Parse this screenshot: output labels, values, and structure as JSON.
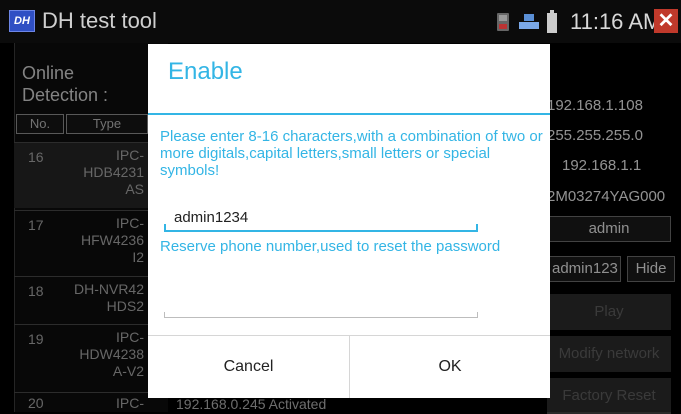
{
  "app": {
    "logo_text": "DH",
    "title": "DH test tool",
    "clock": "11:16 AM",
    "close_glyph": "✕"
  },
  "background": {
    "online_label": "Online",
    "detection_label": "Detection :",
    "col_no": "No.",
    "col_type": "Type",
    "rows": [
      {
        "num": "16",
        "type_lines": [
          "IPC-",
          "HDB4231",
          "AS"
        ]
      },
      {
        "num": "17",
        "type_lines": [
          "IPC-",
          "HFW4236",
          "I2"
        ]
      },
      {
        "num": "18",
        "type_lines": [
          "DH-NVR42",
          "HDS2"
        ]
      },
      {
        "num": "19",
        "type_lines": [
          "IPC-",
          "HDW4238",
          "A-V2"
        ]
      },
      {
        "num": "20",
        "type_lines": [
          "IPC-"
        ]
      }
    ],
    "ip": "192.168.1.108",
    "mask": "255.255.255.0",
    "gateway": "192.168.1.1",
    "serial": "2M03274YAG000",
    "username": "admin",
    "password": "admin123",
    "hide_label": "Hide",
    "play_label": "Play",
    "modify_network_label": "Modify network",
    "factory_reset_label": "Factory Reset",
    "bottom_row_text": "192.168.0.245  Activated"
  },
  "dialog": {
    "title": "Enable",
    "password_hint": "Please enter 8-16 characters,with a combination of two or more digitals,capital letters,small letters or special symbols!",
    "password_value": "admin1234",
    "phone_hint": "Reserve phone number,used to reset the password",
    "phone_value": "",
    "cancel_label": "Cancel",
    "ok_label": "OK"
  },
  "colors": {
    "accent": "#33b5e5",
    "close_red": "#c0392b",
    "logo_blue": "#2f4fc4"
  }
}
